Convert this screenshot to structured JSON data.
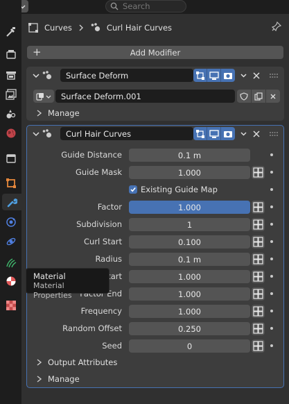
{
  "header": {
    "search_placeholder": "Search"
  },
  "breadcrumb": {
    "object": "Curves",
    "modifier": "Curl Hair Curves"
  },
  "add_modifier": {
    "label": "Add Modifier"
  },
  "surface_deform": {
    "name": "Surface Deform",
    "node_group": "Surface Deform.001",
    "manage_label": "Manage"
  },
  "curl": {
    "name": "Curl Hair Curves",
    "properties": [
      {
        "label": "Guide Distance",
        "value": "0.1 m",
        "keyframe": false,
        "selected": false
      },
      {
        "label": "Guide Mask",
        "value": "1.000",
        "keyframe": true,
        "selected": false
      },
      {
        "label": "Factor",
        "value": "1.000",
        "keyframe": true,
        "selected": true
      },
      {
        "label": "Subdivision",
        "value": "1",
        "keyframe": true,
        "selected": false
      },
      {
        "label": "Curl Start",
        "value": "0.100",
        "keyframe": true,
        "selected": false
      },
      {
        "label": "Radius",
        "value": "0.1 m",
        "keyframe": true,
        "selected": false
      },
      {
        "label": "Factor Start",
        "value": "1.000",
        "keyframe": true,
        "selected": false
      },
      {
        "label": "Factor End",
        "value": "1.000",
        "keyframe": true,
        "selected": false
      },
      {
        "label": "Frequency",
        "value": "1.000",
        "keyframe": true,
        "selected": false
      },
      {
        "label": "Random Offset",
        "value": "0.250",
        "keyframe": true,
        "selected": false
      },
      {
        "label": "Seed",
        "value": "0",
        "keyframe": true,
        "selected": false
      }
    ],
    "existing_guide_map": {
      "label": "Existing Guide Map",
      "checked": true
    },
    "output_attributes_label": "Output Attributes",
    "manage_label": "Manage"
  },
  "tooltip": {
    "title": "Material",
    "description": "Material Properties"
  },
  "colors": {
    "accent": "#4772b3",
    "panel": "#3d3d3d",
    "field": "#545454",
    "background": "#303030"
  }
}
